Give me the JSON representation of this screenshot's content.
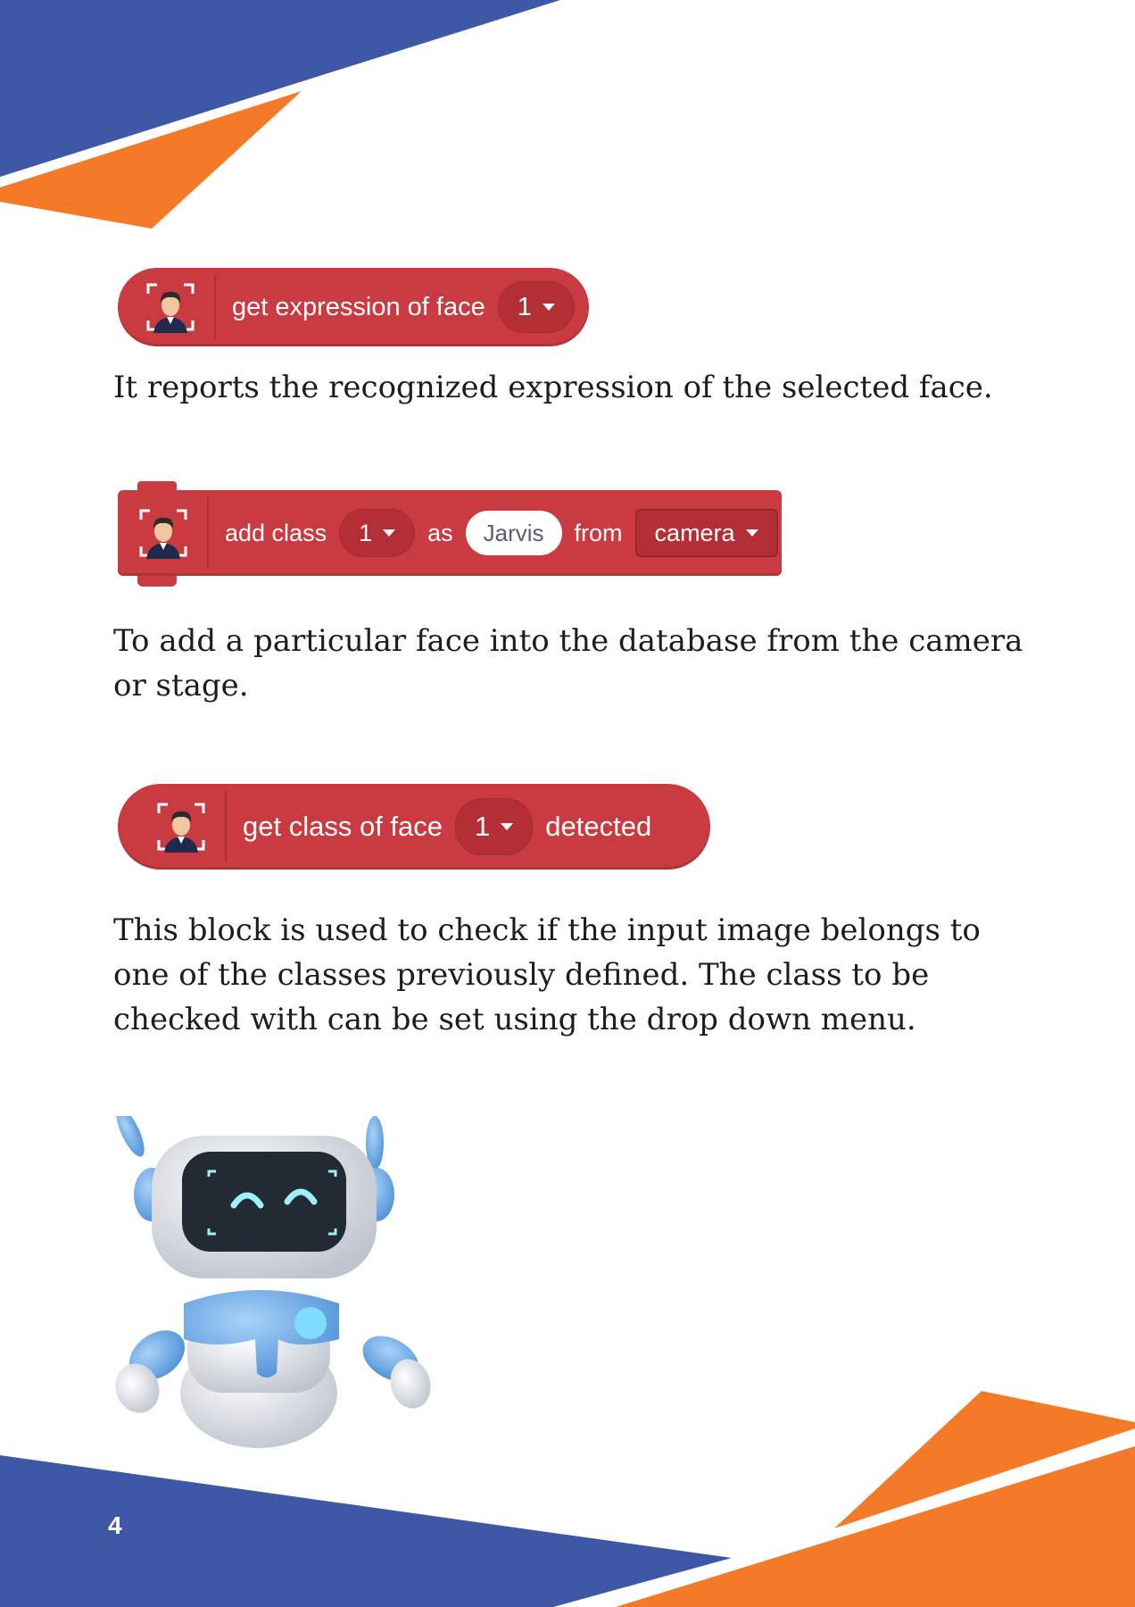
{
  "blocks": [
    {
      "parts": [
        "get expression of face"
      ],
      "dropdown": "1"
    },
    {
      "label_add": "add class",
      "dropdown_class": "1",
      "label_as": "as",
      "input_value": "Jarvis",
      "label_from": "from",
      "dropdown_source": "camera"
    },
    {
      "parts": [
        "get class of face"
      ],
      "dropdown": "1",
      "suffix": "detected"
    }
  ],
  "descriptions": [
    "It reports the recognized expression of the selected face.",
    "To add a particular face into the database from the camera or stage.",
    "This block is used to check if the input image belongs to one of the classes previously defined. The class to be checked with can be set using the drop down menu."
  ],
  "page_number": "4",
  "colors": {
    "block_red": "#c93b40",
    "header_blue": "#3f58a6",
    "accent_orange": "#f47a28"
  },
  "icons": [
    "face-recognition-icon",
    "robot-mascot"
  ]
}
